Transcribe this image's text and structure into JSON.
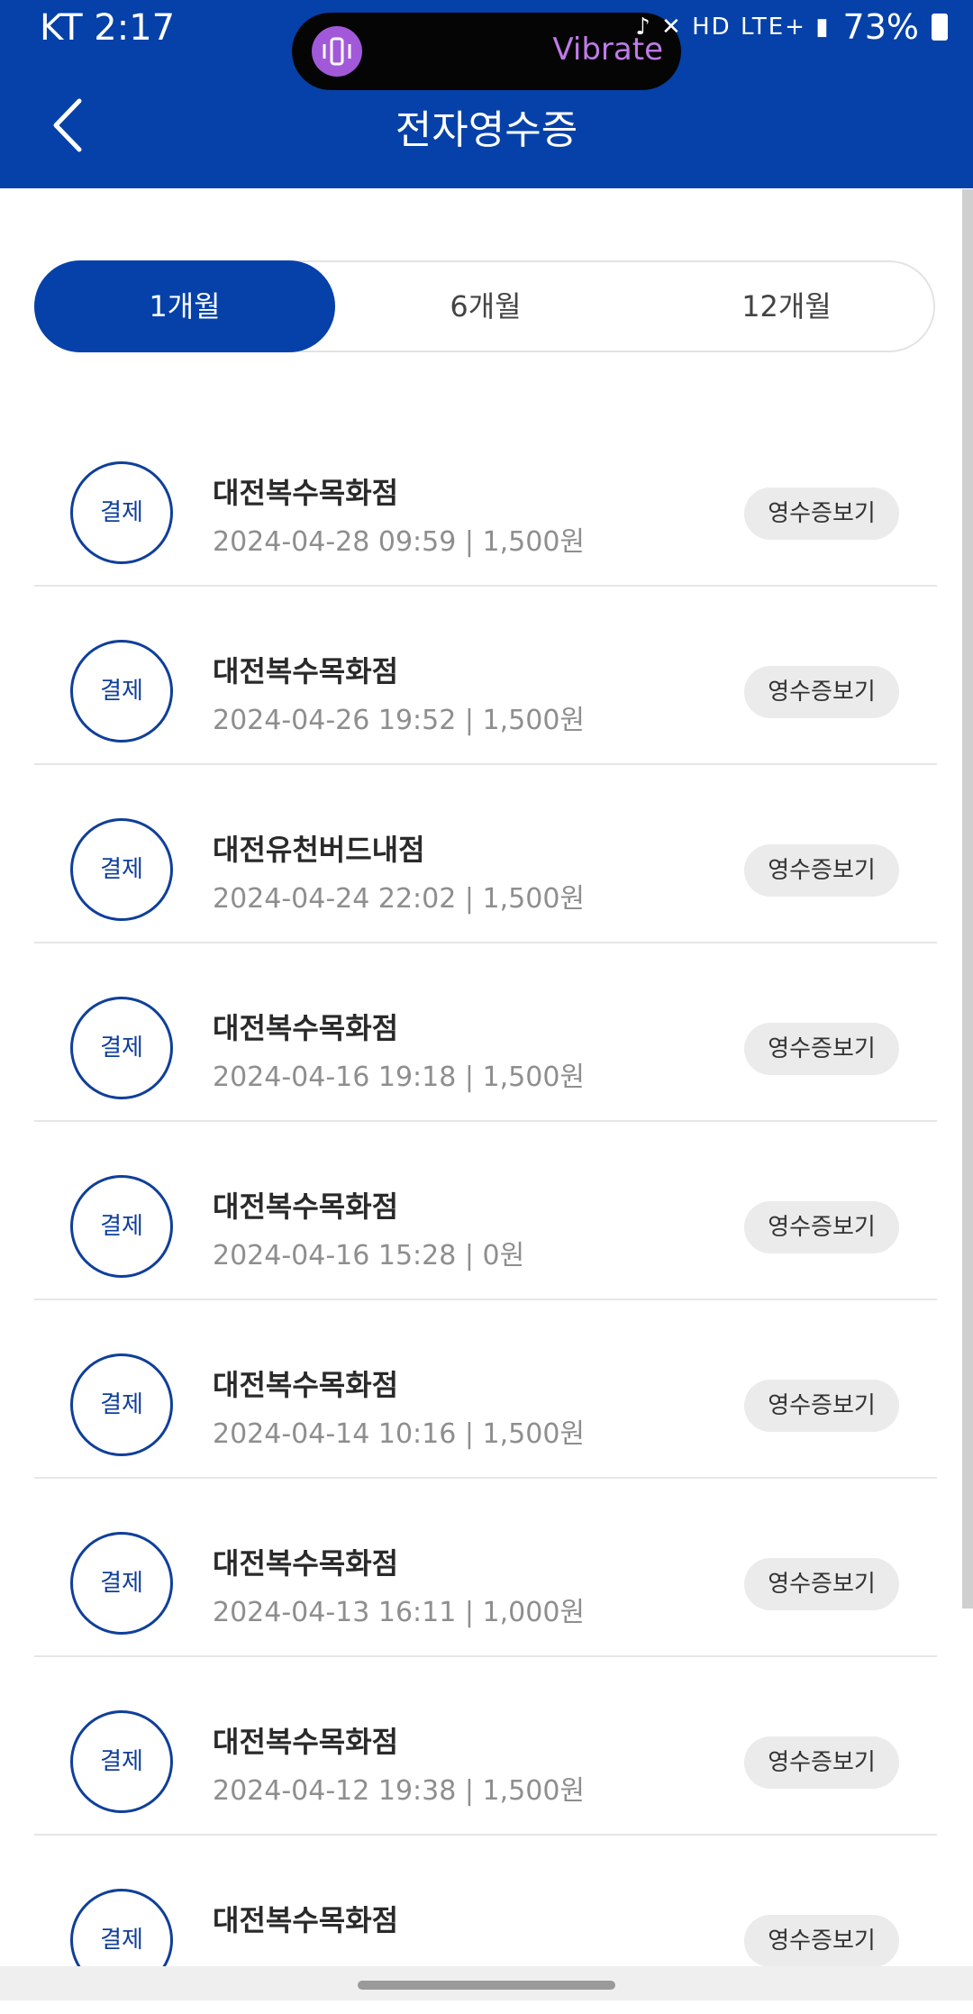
{
  "status_bar": {
    "time": "KT 2:17",
    "vibrate_label": "Vibrate",
    "icons": "♪ ✕ HD LTE+ ▮",
    "battery": "73%"
  },
  "header": {
    "title": "전자영수증"
  },
  "tabs": [
    {
      "label": "1개월",
      "active": true
    },
    {
      "label": "6개월",
      "active": false
    },
    {
      "label": "12개월",
      "active": false
    }
  ],
  "receipts": [
    {
      "badge": "결제",
      "store": "대전복수목화점",
      "datetime": "2024-04-28 09:59",
      "amount": "1,500원",
      "button": "영수증보기"
    },
    {
      "badge": "결제",
      "store": "대전복수목화점",
      "datetime": "2024-04-26 19:52",
      "amount": "1,500원",
      "button": "영수증보기"
    },
    {
      "badge": "결제",
      "store": "대전유천버드내점",
      "datetime": "2024-04-24 22:02",
      "amount": "1,500원",
      "button": "영수증보기"
    },
    {
      "badge": "결제",
      "store": "대전복수목화점",
      "datetime": "2024-04-16 19:18",
      "amount": "1,500원",
      "button": "영수증보기"
    },
    {
      "badge": "결제",
      "store": "대전복수목화점",
      "datetime": "2024-04-16 15:28",
      "amount": "0원",
      "button": "영수증보기"
    },
    {
      "badge": "결제",
      "store": "대전복수목화점",
      "datetime": "2024-04-14 10:16",
      "amount": "1,500원",
      "button": "영수증보기"
    },
    {
      "badge": "결제",
      "store": "대전복수목화점",
      "datetime": "2024-04-13 16:11",
      "amount": "1,000원",
      "button": "영수증보기"
    },
    {
      "badge": "결제",
      "store": "대전복수목화점",
      "datetime": "2024-04-12 19:38",
      "amount": "1,500원",
      "button": "영수증보기"
    },
    {
      "badge": "결제",
      "store": "대전복수목화점",
      "datetime": "",
      "amount": "",
      "button": "영수증보기"
    }
  ],
  "colors": {
    "primary": "#0541a8",
    "badge_blue": "#0f3f9a",
    "text_gray": "#8e8e8e",
    "button_bg": "#ebebeb"
  }
}
